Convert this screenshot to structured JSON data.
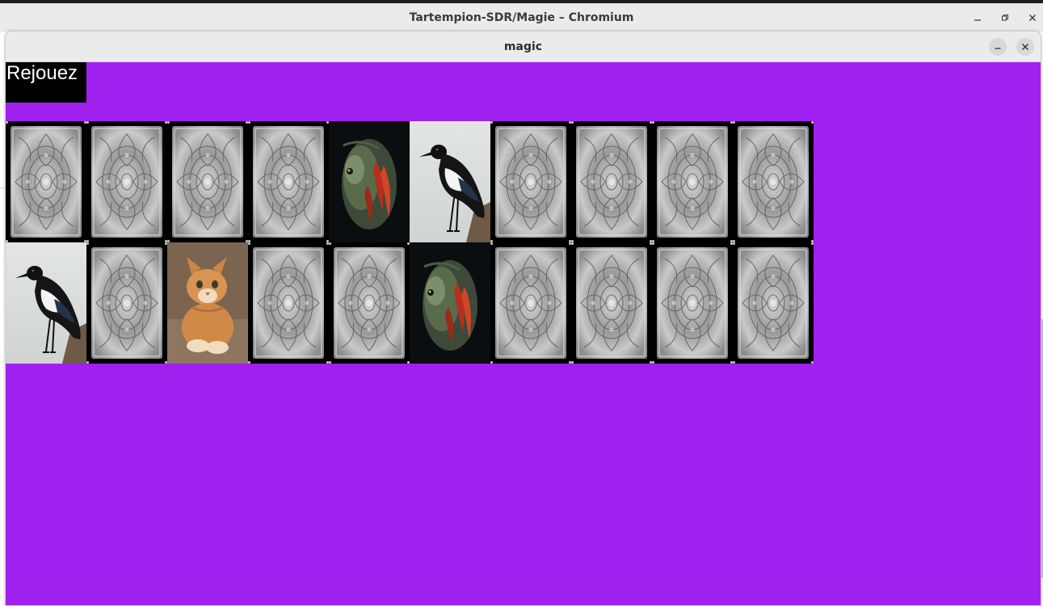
{
  "os_window": {
    "title": "Tartempion-SDR/Magie – Chromium"
  },
  "app_window": {
    "title": "magic"
  },
  "game": {
    "replay_label": "Rejouez",
    "background_color": "#a020f0",
    "cards": [
      {
        "face": "back"
      },
      {
        "face": "back"
      },
      {
        "face": "back"
      },
      {
        "face": "back"
      },
      {
        "face": "fish"
      },
      {
        "face": "magpie"
      },
      {
        "face": "back"
      },
      {
        "face": "back"
      },
      {
        "face": "back"
      },
      {
        "face": "back"
      },
      {
        "face": "magpie"
      },
      {
        "face": "back"
      },
      {
        "face": "kitten"
      },
      {
        "face": "back"
      },
      {
        "face": "back"
      },
      {
        "face": "fish"
      },
      {
        "face": "back"
      },
      {
        "face": "back"
      },
      {
        "face": "back"
      },
      {
        "face": "back"
      }
    ]
  }
}
